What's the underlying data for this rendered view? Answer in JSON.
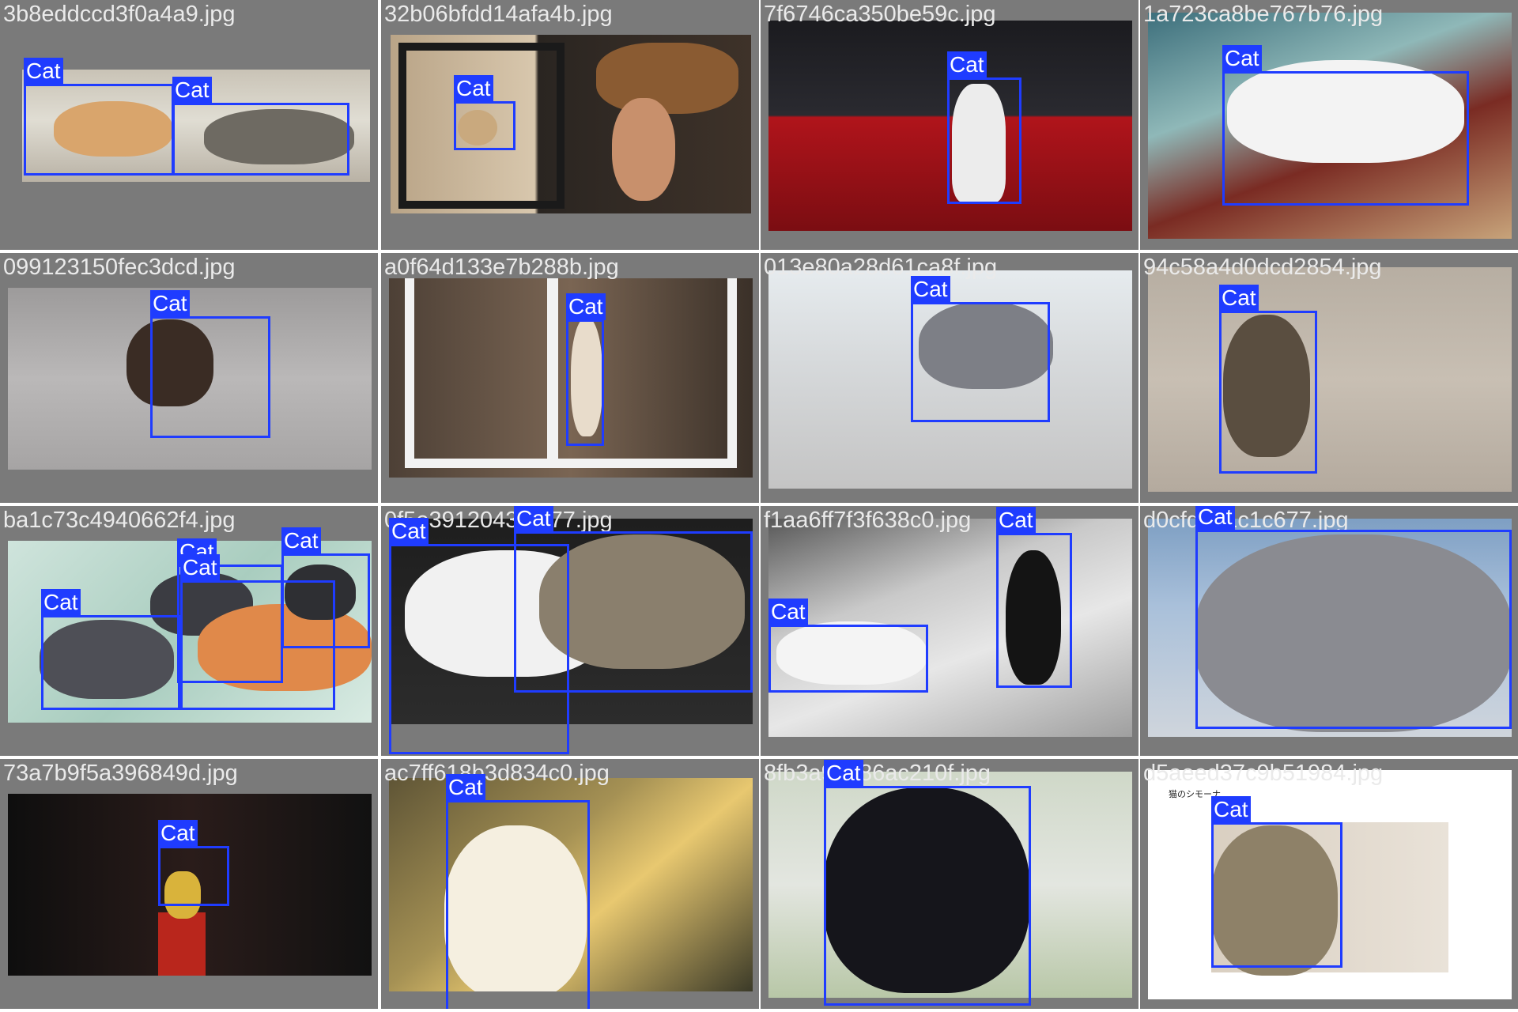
{
  "colors": {
    "cell_bg": "#7a7a7a",
    "box": "#1f3cff",
    "label_text": "#ffffff",
    "filename_text": "#eaeaea"
  },
  "cells": [
    {
      "filename": "3b8eddccd3f0a4a9.jpg",
      "scene": "cats-on-porch",
      "detections": [
        {
          "label": "Cat"
        },
        {
          "label": "Cat"
        }
      ]
    },
    {
      "filename": "32b06bfdd14afa4b.jpg",
      "scene": "dog-and-barrels",
      "detections": [
        {
          "label": "Cat"
        }
      ]
    },
    {
      "filename": "7f6746ca350be59c.jpg",
      "scene": "virtual-stage",
      "detections": [
        {
          "label": "Cat"
        }
      ]
    },
    {
      "filename": "1a723ca8be767b76.jpg",
      "scene": "cat-in-basket",
      "detections": [
        {
          "label": "Cat"
        }
      ]
    },
    {
      "filename": "099123150fec3dcd.jpg",
      "scene": "tortoiseshell-on-pavement",
      "detections": [
        {
          "label": "Cat"
        }
      ]
    },
    {
      "filename": "a0f64d133e7b288b.jpg",
      "scene": "cat-in-window",
      "detections": [
        {
          "label": "Cat"
        }
      ]
    },
    {
      "filename": "013e80a28d61ca8f.jpg",
      "scene": "grey-cat-on-carpet",
      "detections": [
        {
          "label": "Cat"
        }
      ]
    },
    {
      "filename": "94c58a4d0dcd2854.jpg",
      "scene": "tabby-on-sand",
      "detections": [
        {
          "label": "Cat"
        }
      ]
    },
    {
      "filename": "ba1c73c4940662f4.jpg",
      "scene": "kittens-on-blanket",
      "detections": [
        {
          "label": "Cat"
        },
        {
          "label": "Cat"
        },
        {
          "label": "Cat"
        },
        {
          "label": "Cat"
        }
      ]
    },
    {
      "filename": "0f5e3912043f3077.jpg",
      "scene": "sleeping-cats",
      "detections": [
        {
          "label": "Cat"
        },
        {
          "label": "Cat"
        }
      ]
    },
    {
      "filename": "f1aa6ff7f3f638c0.jpg",
      "scene": "cats-on-stairs",
      "detections": [
        {
          "label": "Cat"
        },
        {
          "label": "Cat"
        }
      ]
    },
    {
      "filename": "d0cfd3d1c1c677.jpg",
      "scene": "grey-cat-closeup",
      "detections": [
        {
          "label": "Cat"
        }
      ]
    },
    {
      "filename": "73a7b9f5a396849d.jpg",
      "scene": "lucky-cat-shelf",
      "detections": [
        {
          "label": "Cat"
        }
      ]
    },
    {
      "filename": "ac7ff618b3d834c0.jpg",
      "scene": "cat-in-sunlight",
      "detections": [
        {
          "label": "Cat"
        }
      ]
    },
    {
      "filename": "8fb3a98586ac210f.jpg",
      "scene": "black-fluffy-cat",
      "detections": [
        {
          "label": "Cat"
        }
      ]
    },
    {
      "filename": "d5aeed37c9b51984.jpg",
      "scene": "tabby-profile",
      "caption": "猫のシモーナ",
      "detections": [
        {
          "label": "Cat"
        }
      ]
    }
  ]
}
